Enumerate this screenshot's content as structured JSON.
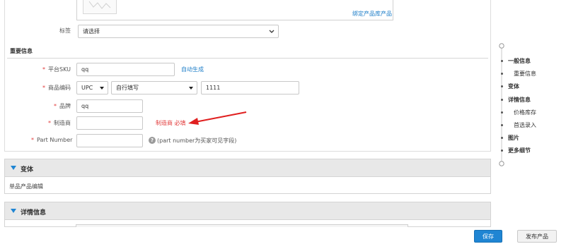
{
  "image_area": {
    "bind_link": "绑定产品库产品"
  },
  "tags": {
    "label": "标签",
    "select_value": "请选择"
  },
  "important_info": {
    "title": "重要信息",
    "fields": {
      "platform_sku": {
        "label": "平台SKU",
        "value": "qq",
        "action": "自动生成"
      },
      "product_code": {
        "label": "商品编码",
        "type_value": "UPC",
        "mode_value": "自行填写",
        "value": "1111"
      },
      "brand": {
        "label": "品牌",
        "value": "qq"
      },
      "manufacturer": {
        "label": "制造商",
        "value": "",
        "note": "制造商 必填"
      },
      "part_number": {
        "label": "Part Number",
        "value": "",
        "hint": "(part number为买家可见字段)"
      }
    },
    "required_mark": "*"
  },
  "variant_section": {
    "title": "变体",
    "body_text": "单品产品编辑"
  },
  "detail_section": {
    "title": "详情信息"
  },
  "side_nav": {
    "items": [
      {
        "label": "一般信息",
        "level": "main"
      },
      {
        "label": "重要信息",
        "level": "sub"
      },
      {
        "label": "变体",
        "level": "main"
      },
      {
        "label": "详情信息",
        "level": "main"
      },
      {
        "label": "价格库存",
        "level": "sub"
      },
      {
        "label": "首选录入",
        "level": "sub"
      },
      {
        "label": "图片",
        "level": "main"
      },
      {
        "label": "更多细节",
        "level": "main"
      }
    ]
  },
  "footer": {
    "save_label": "保存",
    "publish_label": "发布产品"
  },
  "colors": {
    "accent": "#1f85d3",
    "link": "#1e7ec8",
    "required": "#e23b3b",
    "annotation_arrow": "#e01f1f"
  }
}
